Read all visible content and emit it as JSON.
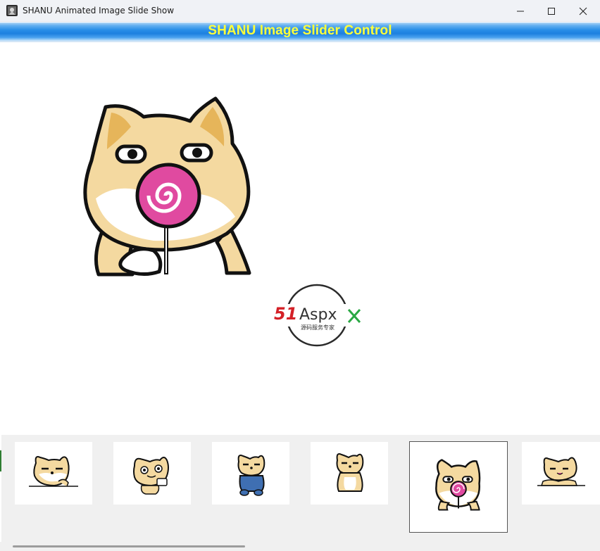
{
  "window": {
    "title": "SHANU Animated Image Slide Show",
    "icon": "app-icon",
    "controls": [
      "minimize-icon",
      "maximize-icon",
      "close-icon"
    ]
  },
  "header": {
    "title": "SHANU Image Slider Control",
    "title_color": "#ffff38",
    "band_color": "#1d80e0"
  },
  "main": {
    "image": "shiba-dog-with-lollipop",
    "watermark": {
      "number": "51",
      "word": "Aspx",
      "subtitle": "源码服务专家"
    }
  },
  "thumbnails": [
    {
      "image": "shiba-dog-at-table",
      "selected": false
    },
    {
      "image": "shiba-dog-with-cup",
      "selected": false
    },
    {
      "image": "shiba-dog-in-overalls",
      "selected": false
    },
    {
      "image": "shiba-dog-standing",
      "selected": false
    },
    {
      "image": "shiba-dog-with-lollipop",
      "selected": true
    },
    {
      "image": "shiba-dog-lying-down",
      "selected": false
    }
  ],
  "colors": {
    "dog_fur": "#f4d9a0",
    "dog_ear": "#e6b55a",
    "lollipop": "#e04aa0",
    "watermark_red": "#d42027",
    "watermark_green": "#2aa844"
  }
}
